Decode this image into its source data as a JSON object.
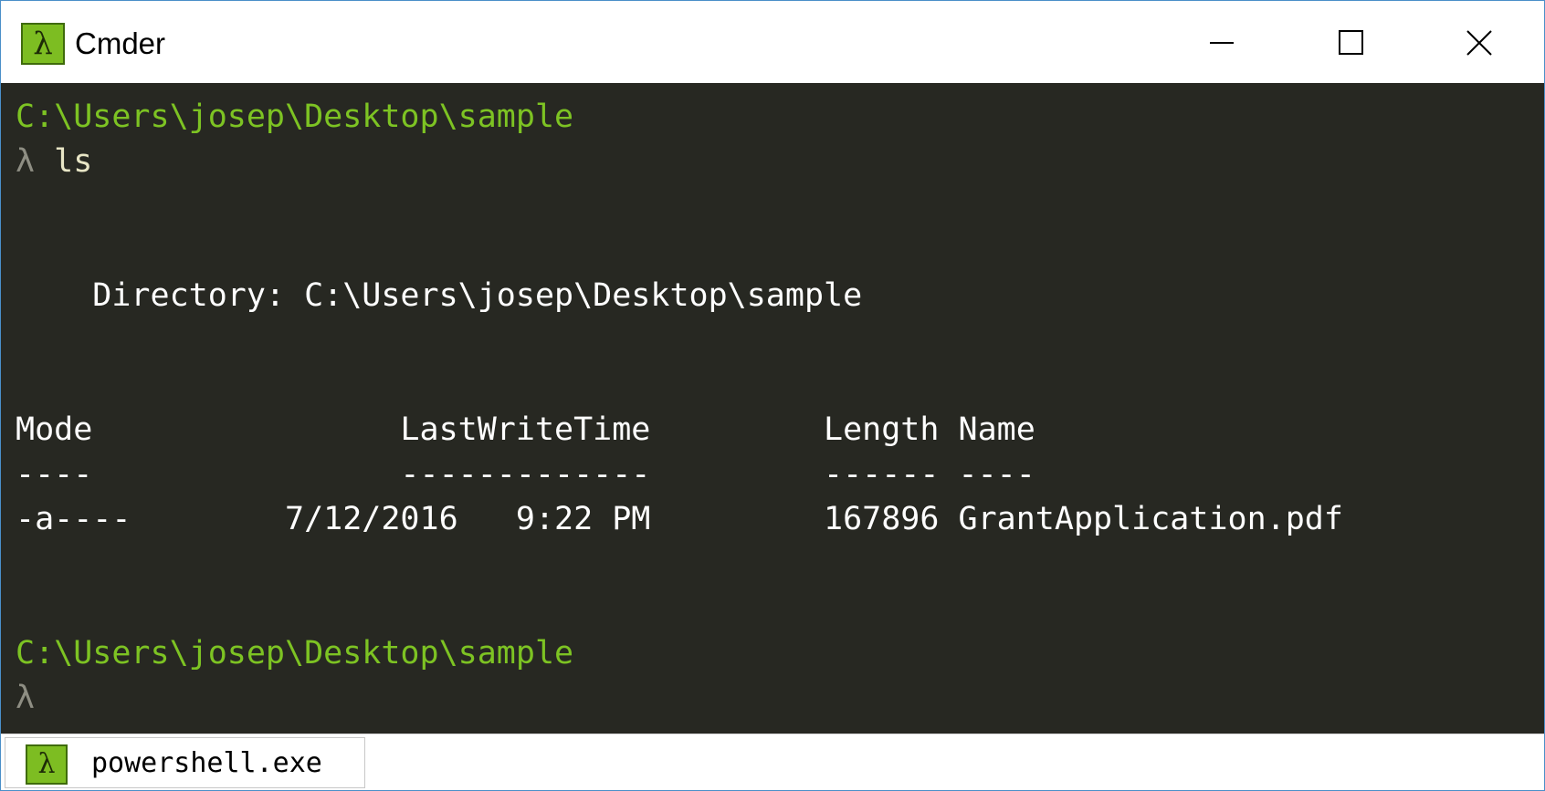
{
  "window": {
    "title": "Cmder",
    "logo_glyph": "λ",
    "accent_color": "#7dbd22"
  },
  "console": {
    "background": "#272822",
    "path_color": "#7dc323",
    "lines": {
      "path1": "C:\\Users\\josep\\Desktop\\sample",
      "prompt1": "λ",
      "command1": "ls",
      "directory": "    Directory: C:\\Users\\josep\\Desktop\\sample",
      "header": "Mode                LastWriteTime         Length Name",
      "separator": "----                -------------         ------ ----",
      "row1": "-a----        7/12/2016   9:22 PM         167896 GrantApplication.pdf",
      "path2": "C:\\Users\\josep\\Desktop\\sample",
      "prompt2": "λ"
    }
  },
  "tabs": [
    {
      "label": "powershell.exe",
      "icon_glyph": "λ"
    }
  ]
}
